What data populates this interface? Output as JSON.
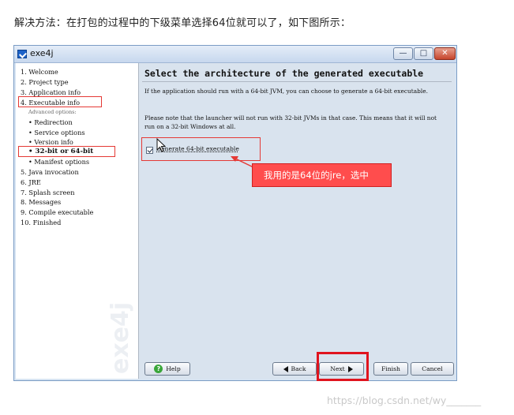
{
  "caption": "解决方法：在打包的过程中的下级菜单选择64位就可以了，如下图所示：",
  "window": {
    "title": "exe4j",
    "controls": {
      "minimize": "—",
      "maximize": "□",
      "close": "✕"
    }
  },
  "sidebar": {
    "items": [
      {
        "label": "1.  Welcome"
      },
      {
        "label": "2.  Project type"
      },
      {
        "label": "3.  Application info"
      },
      {
        "label": "4.  Executable info"
      },
      {
        "label": "Advanced options:"
      },
      {
        "label": "•  Redirection"
      },
      {
        "label": "•  Service options"
      },
      {
        "label": "•  Version info"
      },
      {
        "label": "•  32-bit or 64-bit"
      },
      {
        "label": "•  Manifest options"
      },
      {
        "label": "5.  Java invocation"
      },
      {
        "label": "6.  JRE"
      },
      {
        "label": "7.  Splash screen"
      },
      {
        "label": "8.  Messages"
      },
      {
        "label": "9.  Compile executable"
      },
      {
        "label": "10.  Finished"
      }
    ],
    "watermark": "exe4j"
  },
  "content": {
    "heading": "Select the architecture of the generated executable",
    "para1": "If the application should run with a 64-bit JVM, you can choose to generate a 64-bit executable.",
    "para2": "Please note that the launcher will not run with 32-bit JVMs in that case. This means that it will not run on a 32-bit Windows at all.",
    "checkbox_label": "Generate 64-bit executable",
    "checkbox_checked": true
  },
  "annotation": {
    "callout": "我用的是64位的jre，选中"
  },
  "buttons": {
    "help": "Help",
    "back": "Back",
    "next": "Next",
    "finish": "Finish",
    "cancel": "Cancel"
  },
  "source_watermark": "https://blog.csdn.net/wy_______",
  "colors": {
    "annotation_red": "#e53935",
    "callout_bg": "#ff4d4d",
    "window_border": "#7b9cc4",
    "content_bg": "#d9e3ee"
  }
}
